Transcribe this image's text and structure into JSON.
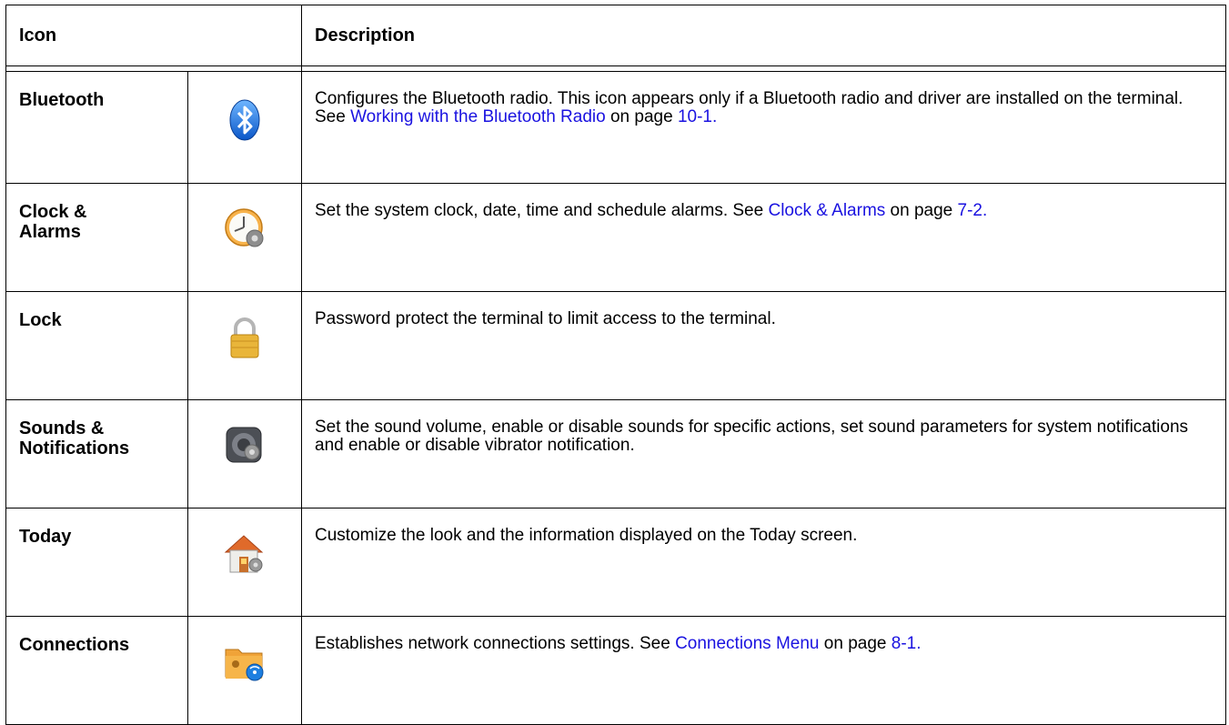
{
  "header": {
    "icon_col": "Icon",
    "desc_col": "Description"
  },
  "rows": [
    {
      "name": "Bluetooth",
      "icon": "bluetooth-icon",
      "desc_pre": "Configures the Bluetooth radio. This icon appears only if a Bluetooth radio and driver are installed on the terminal. See ",
      "link": "Working with the Bluetooth Radio",
      "desc_mid": " on page ",
      "page": "10-1."
    },
    {
      "name_line1": "Clock &",
      "name_line2": "Alarms",
      "icon": "clock-alarms-icon",
      "desc_pre": "Set the system clock, date, time and schedule alarms. See ",
      "link": "Clock & Alarms",
      "desc_mid": " on page ",
      "page": "7-2."
    },
    {
      "name": "Lock",
      "icon": "lock-icon",
      "desc": "Password protect the terminal to limit access to the terminal."
    },
    {
      "name_line1": "Sounds &",
      "name_line2": "Notifications",
      "icon": "sounds-notifications-icon",
      "desc": "Set the sound volume, enable or disable sounds for specific actions, set sound parameters for system notifications and enable or disable vibrator notification."
    },
    {
      "name": "Today",
      "icon": "today-home-icon",
      "desc": "Customize the look and the information displayed on the Today screen."
    },
    {
      "name": "Connections",
      "icon": "connections-folder-icon",
      "desc_pre": "Establishes network connections settings. See ",
      "link": "Connections Menu",
      "desc_mid": " on page ",
      "page": "8-1."
    }
  ],
  "colors": {
    "link": "#1a12e0"
  }
}
